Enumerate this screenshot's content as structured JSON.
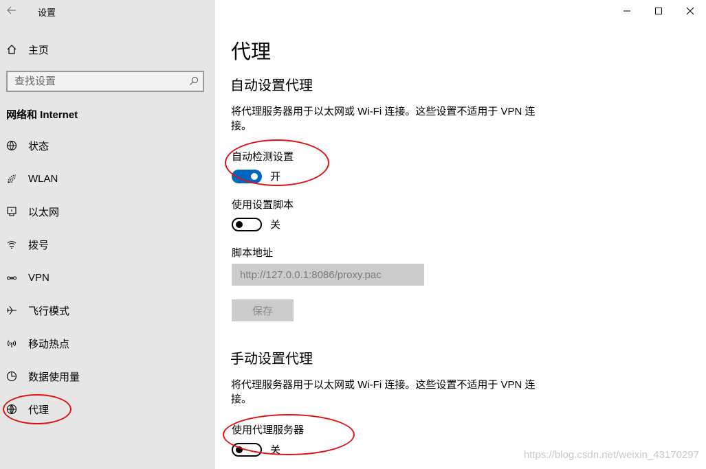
{
  "window": {
    "title": "设置",
    "controls": [
      "minimize-icon",
      "maximize-icon",
      "close-icon"
    ]
  },
  "sidebar": {
    "home_label": "主页",
    "search_placeholder": "查找设置",
    "section_title": "网络和 Internet",
    "items": [
      {
        "label": "状态",
        "icon": "globe-status-icon"
      },
      {
        "label": "WLAN",
        "icon": "wifi-icon"
      },
      {
        "label": "以太网",
        "icon": "ethernet-icon"
      },
      {
        "label": "拨号",
        "icon": "dialup-icon"
      },
      {
        "label": "VPN",
        "icon": "vpn-icon"
      },
      {
        "label": "飞行模式",
        "icon": "airplane-icon"
      },
      {
        "label": "移动热点",
        "icon": "hotspot-icon"
      },
      {
        "label": "数据使用量",
        "icon": "data-usage-icon"
      },
      {
        "label": "代理",
        "icon": "globe-icon",
        "selected": true
      }
    ]
  },
  "main": {
    "page_title": "代理",
    "auto": {
      "heading": "自动设置代理",
      "description": "将代理服务器用于以太网或 Wi-Fi 连接。这些设置不适用于 VPN 连接。",
      "detect_label": "自动检测设置",
      "detect_state": "开",
      "script_label": "使用设置脚本",
      "script_state": "关",
      "address_label": "脚本地址",
      "address_value": "http://127.0.0.1:8086/proxy.pac",
      "save_label": "保存"
    },
    "manual": {
      "heading": "手动设置代理",
      "description": "将代理服务器用于以太网或 Wi-Fi 连接。这些设置不适用于 VPN 连接。",
      "proxy_label": "使用代理服务器",
      "proxy_state": "关"
    }
  },
  "watermark": "https://blog.csdn.net/weixin_43170297",
  "colors": {
    "sidebar_bg": "#e6e6e6",
    "toggle_on": "#0067c0",
    "annotation": "#e01010"
  }
}
